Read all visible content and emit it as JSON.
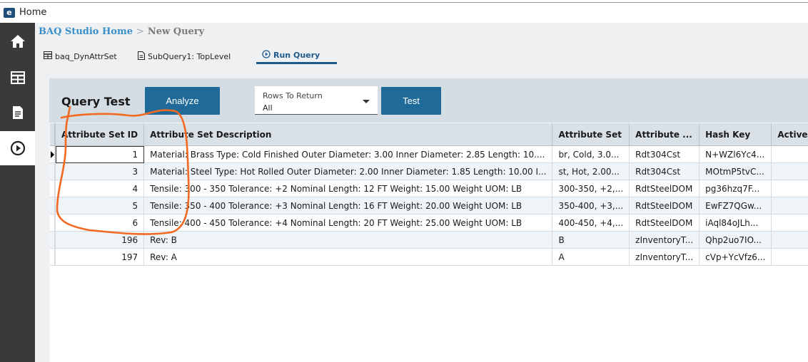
{
  "window": {
    "title": "Home",
    "logo_glyph": "e"
  },
  "sidebar": {
    "items": [
      {
        "icon": "home-icon",
        "active": false
      },
      {
        "icon": "grid-table-icon",
        "active": false
      },
      {
        "icon": "document-icon",
        "active": false
      },
      {
        "icon": "play-circle-icon",
        "active": true
      }
    ]
  },
  "breadcrumb": {
    "home": "BAQ Studio Home",
    "separator": ">",
    "current": "New Query"
  },
  "tabs": [
    {
      "label": "baq_DynAttrSet",
      "icon": "table-icon"
    },
    {
      "label": "SubQuery1: TopLevel",
      "icon": "document-icon"
    },
    {
      "label": "Run Query",
      "icon": "play-circle-icon",
      "active": true
    }
  ],
  "query_test": {
    "title": "Query Test",
    "analyze_label": "Analyze",
    "rows_label": "Rows To Return",
    "rows_value": "All",
    "test_label": "Test"
  },
  "grid": {
    "columns": [
      "Attribute Set ID",
      "Attribute Set Description",
      "Attribute Set",
      "Attribute ...",
      "Hash Key",
      "Active"
    ],
    "rows": [
      [
        "1",
        "Material: Brass Type: Cold Finished Outer Diameter: 3.00 Inner Diameter: 2.85 Length: 10....",
        "br, Cold, 3.0...",
        "Rdt304Cst",
        "N+WZl6Yc4..."
      ],
      [
        "3",
        "Material: Steel Type: Hot Rolled Outer Diameter: 2.00 Inner Diameter: 1.85 Length: 10.00 I...",
        "st, Hot, 2.00...",
        "Rdt304Cst",
        "MOtmP5tvC..."
      ],
      [
        "4",
        "Tensile: 300 - 350 Tolerance: +2 Nominal Length: 12 FT Weight: 15.00 Weight UOM: LB",
        "300-350, +2,...",
        "RdtSteelDOM",
        "pg36hzq7F..."
      ],
      [
        "5",
        "Tensile: 350 - 400 Tolerance: +3 Nominal Length: 16 FT Weight: 20.00 Weight UOM: LB",
        "350-400, +3,...",
        "RdtSteelDOM",
        "EwFZ7QGw..."
      ],
      [
        "6",
        "Tensile: 400 - 450 Tolerance: +4 Nominal Length: 20 FT Weight: 25.00 Weight UOM: LB",
        "400-450, +4,...",
        "RdtSteelDOM",
        "iAql84oJLh..."
      ],
      [
        "196",
        "Rev: B",
        "B",
        "zInventoryT...",
        "Qhp2uo7IO..."
      ],
      [
        "197",
        "Rev: A",
        "A",
        "zInventoryT...",
        "cVp+YcVfz6..."
      ]
    ]
  },
  "colors": {
    "sidebar": "#3a3a3a",
    "accent": "#1f6a99",
    "breadcrumb_home": "#3a8fc7",
    "annotation": "#f26a21"
  }
}
